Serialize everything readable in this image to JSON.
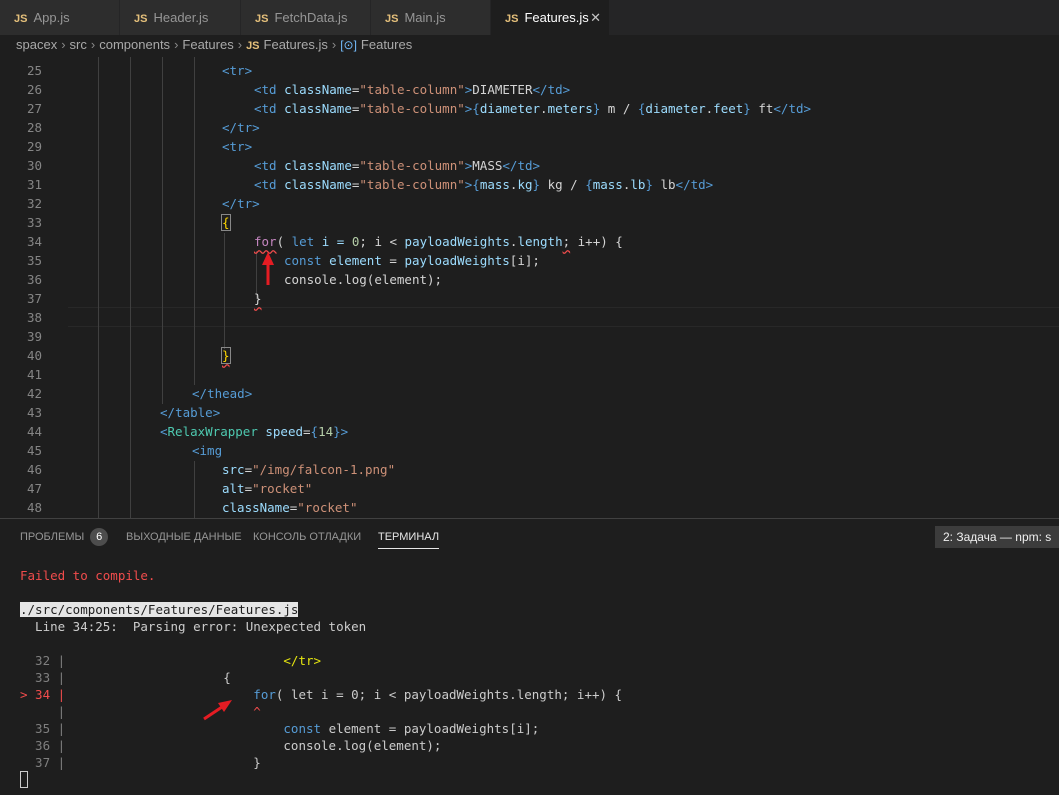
{
  "tabs": [
    {
      "icon": "JS",
      "label": "App.js"
    },
    {
      "icon": "JS",
      "label": "Header.js"
    },
    {
      "icon": "JS",
      "label": "FetchData.js"
    },
    {
      "icon": "JS",
      "label": "Main.js"
    },
    {
      "icon": "JS",
      "label": "Features.js",
      "close": "✕"
    }
  ],
  "breadcrumb": {
    "spacex": "spacex",
    "src": "src",
    "components": "components",
    "features_dir": "Features",
    "file_icon": "JS",
    "file": "Features.js",
    "symbol_icon": "[⊙]",
    "symbol": "Features",
    "sep": "›"
  },
  "editor": {
    "lines": {
      "l25": "25",
      "l26": "26",
      "l27": "27",
      "l28": "28",
      "l29": "29",
      "l30": "30",
      "l31": "31",
      "l32": "32",
      "l33": "33",
      "l34": "34",
      "l35": "35",
      "l36": "36",
      "l37": "37",
      "l38": "38",
      "l39": "39",
      "l40": "40",
      "l41": "41",
      "l42": "42",
      "l43": "43",
      "l44": "44",
      "l45": "45",
      "l46": "46",
      "l47": "47",
      "l48": "48"
    },
    "code": {
      "lt": "<",
      "gt": ">",
      "lt_slash": "</",
      "tr": "tr",
      "td": "td",
      "thead": "thead",
      "table": "table",
      "img": "img",
      "relax": "RelaxWrapper",
      "classname": "className",
      "eq": "=",
      "table_column": "\"table-column\"",
      "diameter": "DIAMETER",
      "mass": "MASS",
      "open_brace": "{",
      "close_brace": "}",
      "diameter_obj": "diameter",
      "meters": "meters",
      "feet": "feet",
      "dot": ".",
      "m_sep": " m / ",
      "ft": " ft",
      "mass_obj": "mass",
      "kg": "kg",
      "lb": "lb",
      "kg_sep": " kg / ",
      "lb_suffix": " lb",
      "for_kw": "for",
      "for_open": "( ",
      "let_kw": "let",
      "i_assign": " i = ",
      "zero": "0",
      "semi_i_lt": "; i < ",
      "payload": "payloadWeights",
      "length": "length",
      "semi": ";",
      "i_inc": " i++) {",
      "const_kw": "const",
      "element_var": "element",
      "assign": " = ",
      "index_i": "[i];",
      "console": "console",
      "log": "log",
      "log_args": "(element);",
      "speed": "speed",
      "speed_val": "14",
      "src_attr": "src",
      "src_val": "\"/img/falcon-1.png\"",
      "alt_attr": "alt",
      "alt_val": "\"rocket\"",
      "class_val": "\"rocket\""
    }
  },
  "panel": {
    "tabs": {
      "problems": "ПРОБЛЕМЫ",
      "problems_count": "6",
      "output": "ВЫХОДНЫЕ ДАННЫЕ",
      "debug": "КОНСОЛЬ ОТЛАДКИ",
      "terminal": "ТЕРМИНАЛ"
    },
    "task_select": "2: Задача — npm: s"
  },
  "terminal": {
    "failed": "Failed to compile.",
    "path": "./src/components/Features/Features.js",
    "error": "  Line 34:25:  Parsing error: Unexpected token",
    "n32": "  32 | ",
    "n33": "  33 | ",
    "n34": "> 34 | ",
    "nblank": "     | ",
    "n35": "  35 | ",
    "n36": "  36 | ",
    "n37": "  37 | ",
    "c32": "                            </tr>",
    "c33": "                    {",
    "c34_for": "                        for",
    "c34_rest": "( let i = 0; i < payloadWeights.length; i++) {",
    "caret": "                        ^",
    "c35_const": "                            const",
    "c35_rest": " element = payloadWeights[i];",
    "c36": "                            console.log(element);",
    "c37": "                        }"
  },
  "colors": {
    "arrow": "#e51c23"
  }
}
